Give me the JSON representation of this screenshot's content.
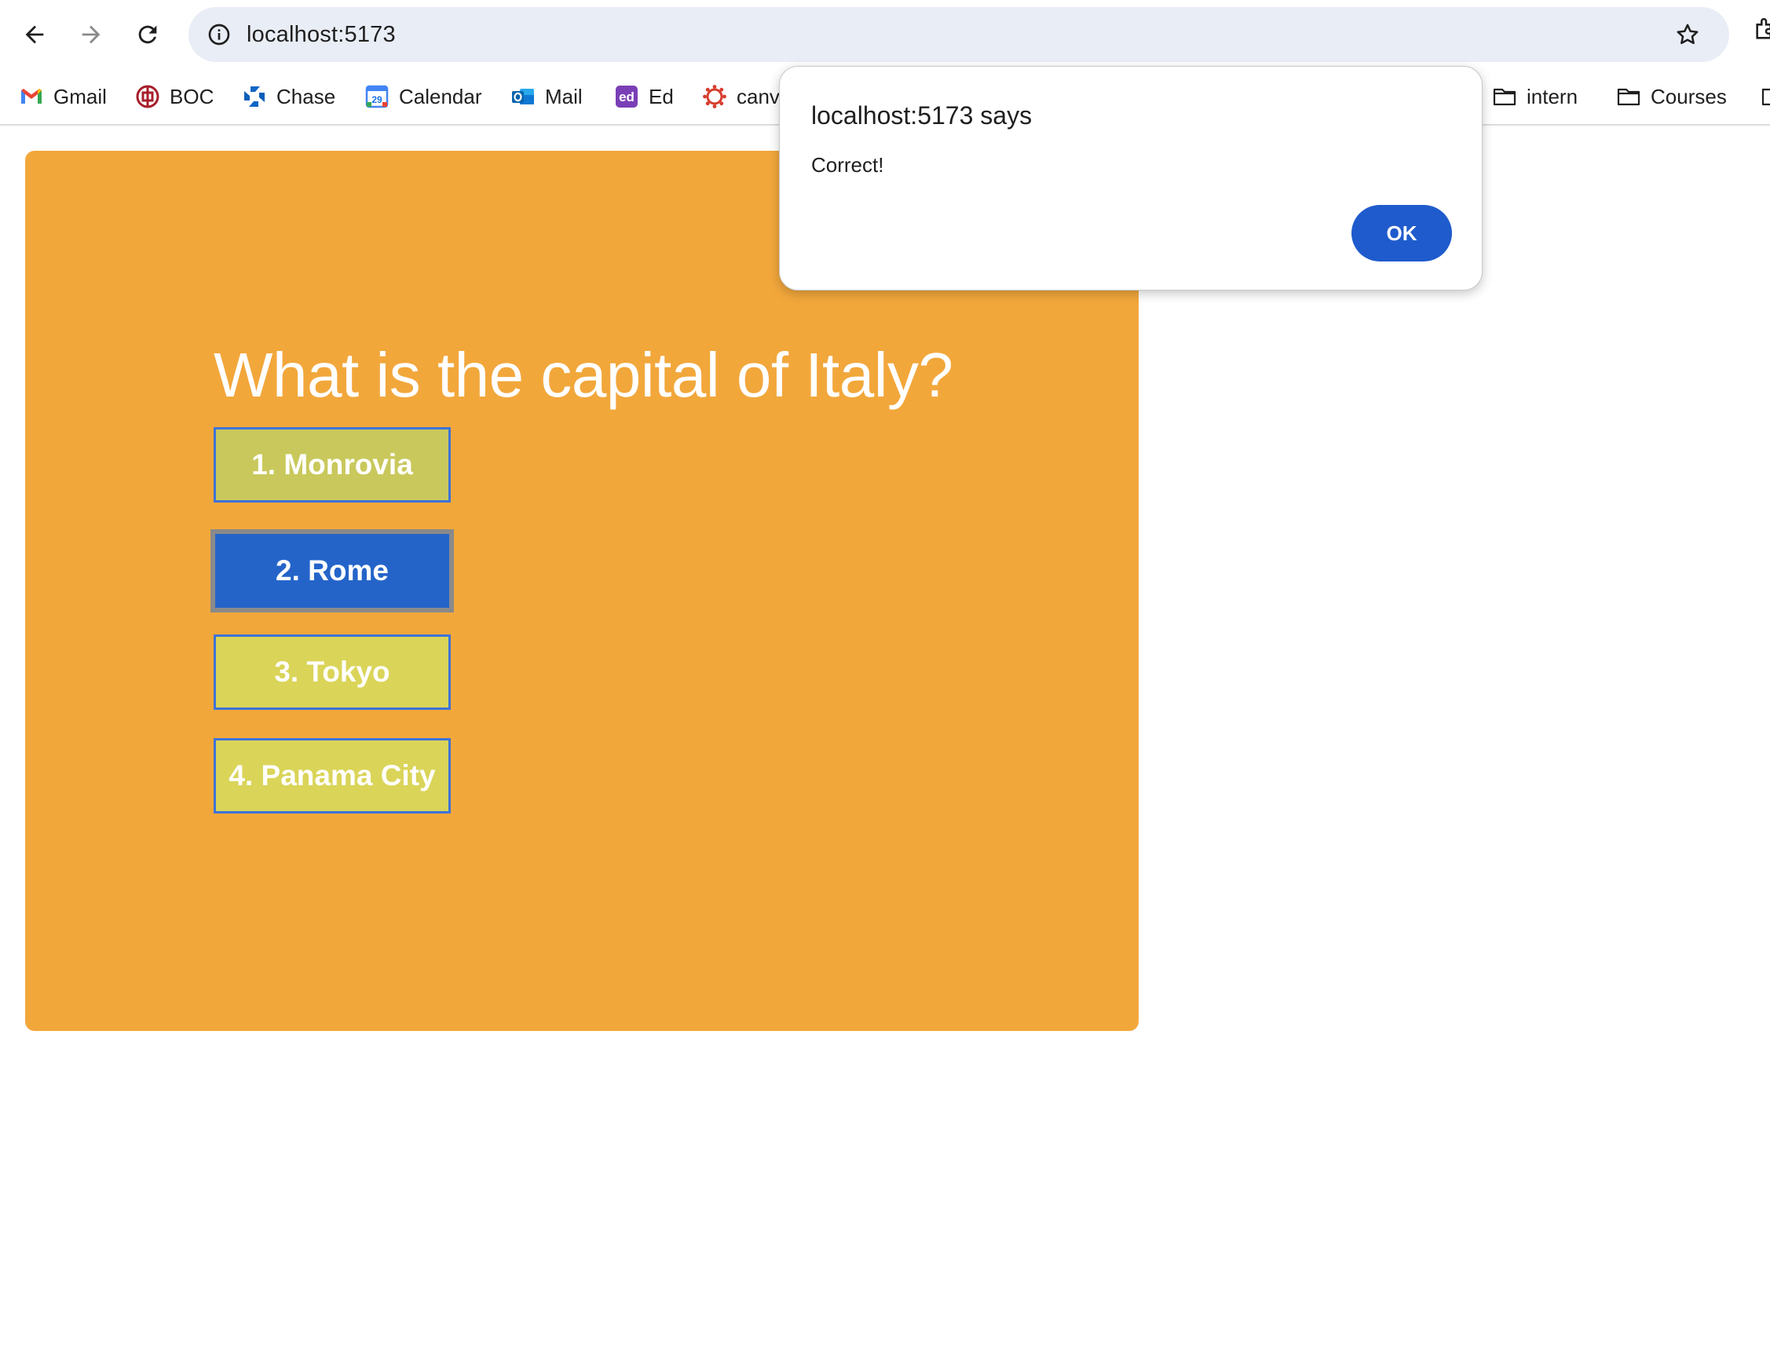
{
  "browser": {
    "url": "localhost:5173",
    "bookmarks": [
      {
        "label": "Gmail",
        "icon": "gmail-icon"
      },
      {
        "label": "BOC",
        "icon": "boc-icon"
      },
      {
        "label": "Chase",
        "icon": "chase-icon"
      },
      {
        "label": "Calendar",
        "icon": "calendar-icon",
        "icon_text": "29"
      },
      {
        "label": "Mail",
        "icon": "outlook-icon"
      },
      {
        "label": "Ed",
        "icon": "ed-icon",
        "icon_text": "ed"
      },
      {
        "label": "canv",
        "icon": "canvas-icon"
      },
      {
        "label": "intern",
        "icon": "folder-icon"
      },
      {
        "label": "Courses",
        "icon": "folder-icon"
      }
    ]
  },
  "quiz": {
    "question": "What is the capital of Italy?",
    "answers": [
      {
        "label": "1. Monrovia",
        "color": "#c9c85c"
      },
      {
        "label": "2. Rome",
        "color": "#2464c9",
        "state": "selected"
      },
      {
        "label": "3. Tokyo",
        "color": "#dad459"
      },
      {
        "label": "4. Panama City",
        "color": "#dad459"
      }
    ],
    "card_color": "#f2a73b"
  },
  "dialog": {
    "title": "localhost:5173 says",
    "message": "Correct!",
    "ok_label": "OK",
    "ok_color": "#1f5bcc"
  }
}
